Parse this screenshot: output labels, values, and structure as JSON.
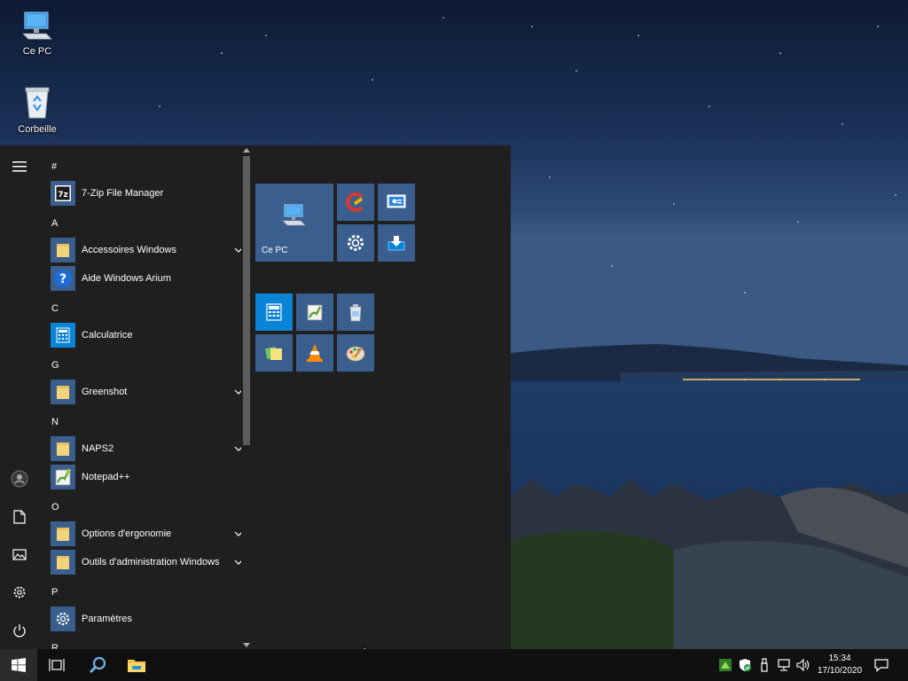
{
  "desktop": {
    "icons": [
      {
        "label": "Ce PC",
        "icon": "computer-icon"
      },
      {
        "label": "Corbeille",
        "icon": "recycle-bin-icon"
      }
    ]
  },
  "start_menu": {
    "rail": [
      "hamburger-menu-icon",
      "user-icon",
      "documents-icon",
      "pictures-icon",
      "settings-icon",
      "power-icon"
    ],
    "sections": [
      {
        "letter": "#",
        "apps": [
          {
            "name": "7-Zip File Manager",
            "icon": "7zip-icon",
            "expandable": false
          }
        ]
      },
      {
        "letter": "A",
        "apps": [
          {
            "name": "Accessoires Windows",
            "icon": "folder-icon",
            "expandable": true
          },
          {
            "name": "Aide Windows Arium",
            "icon": "help-icon",
            "expandable": false
          }
        ]
      },
      {
        "letter": "C",
        "apps": [
          {
            "name": "Calculatrice",
            "icon": "calculator-icon",
            "expandable": false
          }
        ]
      },
      {
        "letter": "G",
        "apps": [
          {
            "name": "Greenshot",
            "icon": "folder-icon",
            "expandable": true
          }
        ]
      },
      {
        "letter": "N",
        "apps": [
          {
            "name": "NAPS2",
            "icon": "folder-icon",
            "expandable": true
          },
          {
            "name": "Notepad++",
            "icon": "notepadpp-icon",
            "expandable": false
          }
        ]
      },
      {
        "letter": "O",
        "apps": [
          {
            "name": "Options d'ergonomie",
            "icon": "folder-icon",
            "expandable": true
          },
          {
            "name": "Outils d'administration Windows",
            "icon": "folder-icon",
            "expandable": true
          }
        ]
      },
      {
        "letter": "P",
        "apps": [
          {
            "name": "Paramètres",
            "icon": "settings-icon",
            "expandable": false
          }
        ]
      },
      {
        "letter": "R",
        "apps": []
      }
    ],
    "tiles": {
      "large_label": "Ce PC",
      "small": [
        "ccleaner-icon",
        "remote-desktop-icon",
        "settings-icon",
        "download-icon",
        "calculator-icon",
        "notepadpp-icon",
        "paste-icon",
        "sticky-notes-icon",
        "vlc-icon",
        "paint-icon"
      ]
    }
  },
  "taskbar": {
    "buttons": [
      "start-icon",
      "task-view-icon",
      "search-icon",
      "file-explorer-icon"
    ],
    "tray": [
      "greenshot-icon",
      "defender-icon",
      "usb-icon",
      "network-icon",
      "volume-icon"
    ],
    "time": "15:34",
    "date": "17/10/2020"
  },
  "colors": {
    "tile": "#3a5f8f",
    "menu_bg": "#1f1f1f",
    "taskbar_bg": "#101010",
    "accent": "#0a84d6"
  }
}
